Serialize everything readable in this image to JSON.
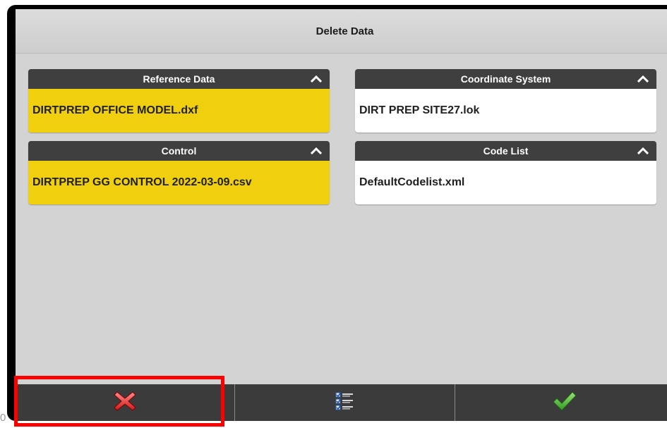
{
  "window": {
    "title": "Delete Data"
  },
  "panels": {
    "reference_data": {
      "title": "Reference Data",
      "value": "DIRTPREP OFFICE MODEL.dxf"
    },
    "coordinate_system": {
      "title": "Coordinate System",
      "value": "DIRT PREP SITE27.lok"
    },
    "control": {
      "title": "Control",
      "value": "DIRTPREP GG CONTROL 2022-03-09.csv"
    },
    "code_list": {
      "title": "Code List",
      "value": "DefaultCodelist.xml"
    }
  },
  "toolbar": {
    "cancel_icon": "red-x-icon",
    "select_icon": "checklist-icon",
    "confirm_icon": "green-check-icon"
  },
  "edge_text": "0",
  "colors": {
    "selected_fill": "#f0cf0e",
    "header_fill": "#3f3f3f",
    "highlight": "#ff0000"
  }
}
